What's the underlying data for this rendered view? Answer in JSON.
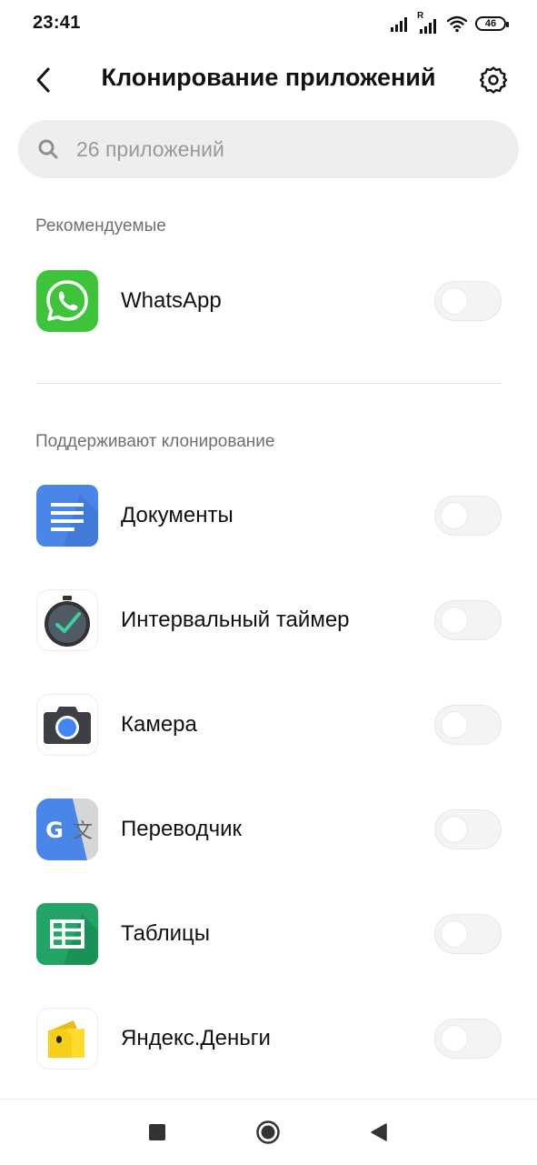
{
  "status_bar": {
    "time": "23:41",
    "battery": "46",
    "roaming": "R"
  },
  "header": {
    "title": "Клонирование приложений"
  },
  "search": {
    "placeholder": "26 приложений"
  },
  "sections": {
    "recommended": {
      "label": "Рекомендуемые",
      "apps": [
        {
          "name": "WhatsApp",
          "enabled": false
        }
      ]
    },
    "supported": {
      "label": "Поддерживают клонирование",
      "apps": [
        {
          "name": "Документы",
          "enabled": false
        },
        {
          "name": "Интервальный таймер",
          "enabled": false
        },
        {
          "name": "Камера",
          "enabled": false
        },
        {
          "name": "Переводчик",
          "enabled": false
        },
        {
          "name": "Таблицы",
          "enabled": false
        },
        {
          "name": "Яндекс.Деньги",
          "enabled": false
        }
      ]
    }
  },
  "colors": {
    "whatsapp_green": "#3ec43a",
    "docs_blue": "#4a86e8",
    "sheets_green": "#21a464",
    "yandex_yellow": "#ffdb2b",
    "toggle_off": "#f4f4f4",
    "section_label": "#707070"
  },
  "icons": {
    "back": "chevron-left-icon",
    "settings": "gear-icon",
    "search": "search-icon",
    "nav_recents": "square-icon",
    "nav_home": "circle-icon",
    "nav_back": "triangle-back-icon"
  }
}
